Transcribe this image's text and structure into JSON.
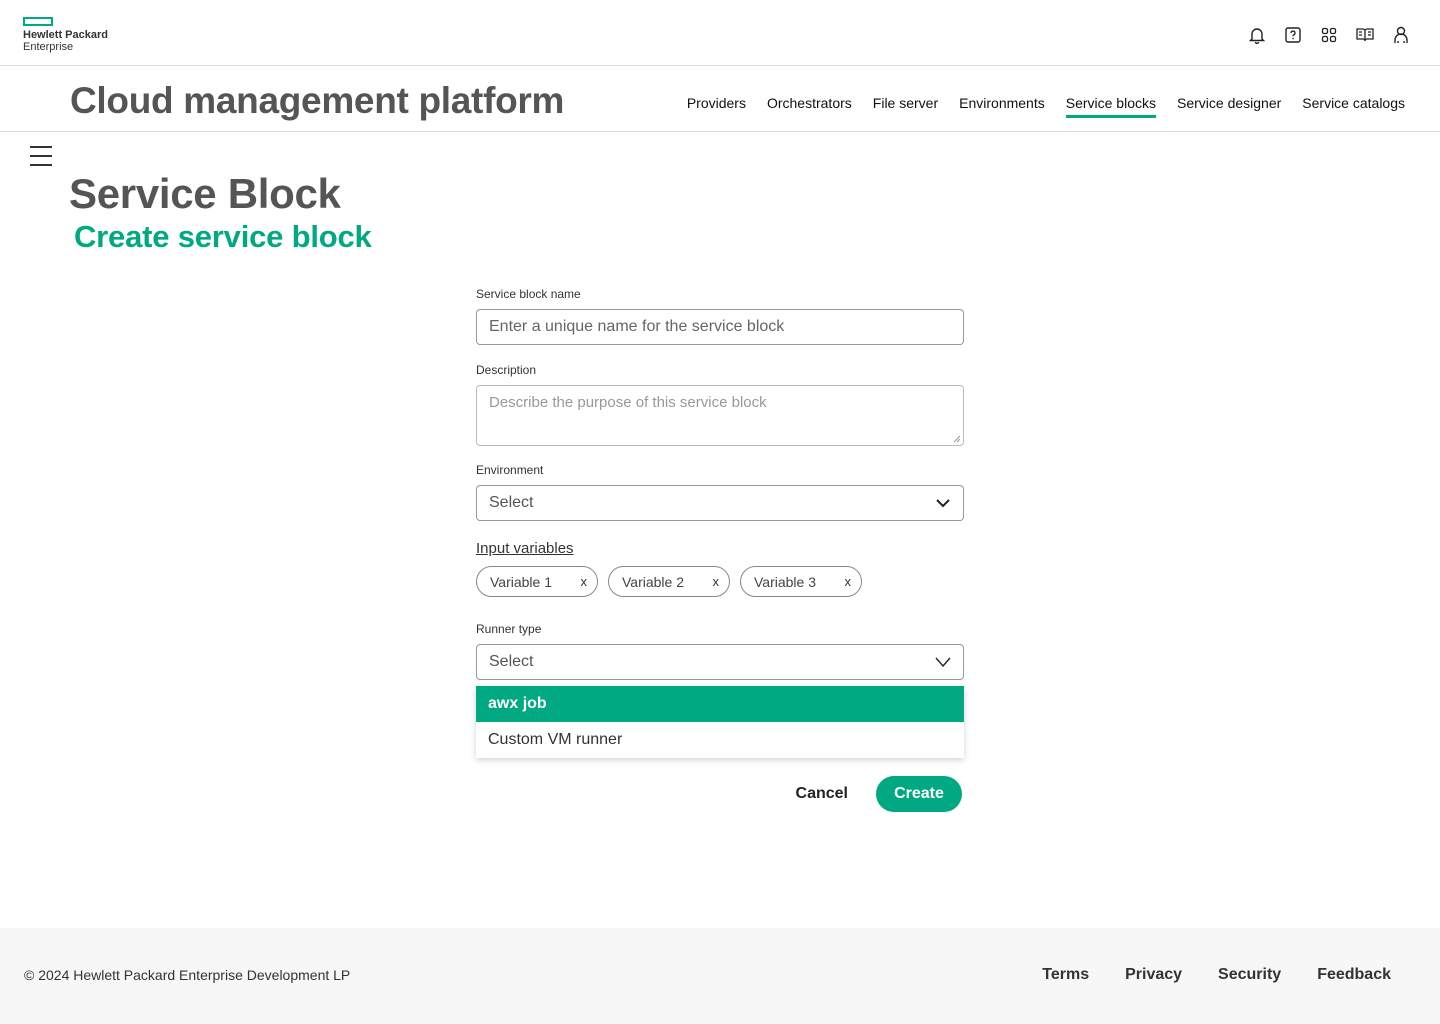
{
  "brand": {
    "line1": "Hewlett Packard",
    "line2": "Enterprise",
    "accent": "#01a982"
  },
  "top_icons": [
    "bell-icon",
    "help-icon",
    "apps-grid-icon",
    "book-icon",
    "user-icon"
  ],
  "header": {
    "app_title": "Cloud management platform",
    "nav": [
      {
        "label": "Providers",
        "active": false
      },
      {
        "label": "Orchestrators",
        "active": false
      },
      {
        "label": "File server",
        "active": false
      },
      {
        "label": "Environments",
        "active": false
      },
      {
        "label": "Service blocks",
        "active": true
      },
      {
        "label": "Service designer",
        "active": false
      },
      {
        "label": "Service catalogs",
        "active": false
      }
    ]
  },
  "page": {
    "title": "Service Block",
    "subtitle": "Create service block"
  },
  "form": {
    "name_label": "Service block name",
    "name_placeholder": "Enter a unique name for the service block",
    "description_label": "Description",
    "description_placeholder": "Describe the purpose of this service block",
    "environment_label": "Environment",
    "environment_value": "Select",
    "input_variables_label": "Input variables",
    "variables": [
      {
        "label": "Variable 1",
        "remove": "x"
      },
      {
        "label": "Variable 2",
        "remove": "x"
      },
      {
        "label": "Variable 3",
        "remove": "x"
      }
    ],
    "runner_label": "Runner type",
    "runner_value": "Select",
    "runner_options": [
      {
        "label": "awx job",
        "selected": true
      },
      {
        "label": "Custom VM runner",
        "selected": false
      }
    ],
    "cancel_label": "Cancel",
    "create_label": "Create"
  },
  "footer": {
    "copyright": "© 2024 Hewlett Packard Enterprise Development LP",
    "links": [
      "Terms",
      "Privacy",
      "Security",
      "Feedback"
    ]
  }
}
